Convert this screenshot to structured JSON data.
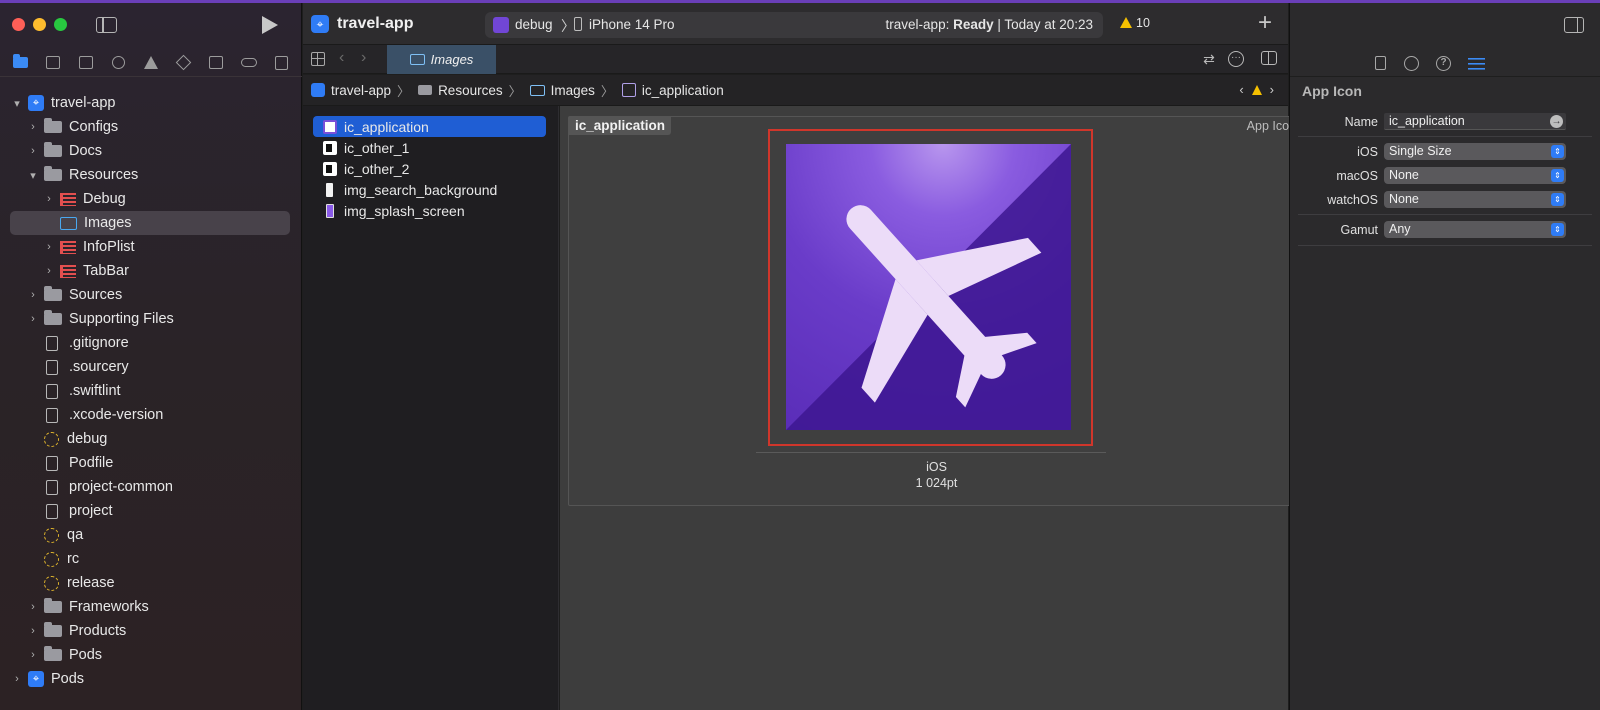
{
  "window": {
    "project_title": "travel-app",
    "scheme": "debug",
    "device": "iPhone 14 Pro",
    "status_prefix": "travel-app:",
    "status_state": "Ready",
    "status_suffix": "| Today at 20:23",
    "warnings_count": "10",
    "accent_color": "#6a3fb8"
  },
  "navigator": {
    "tree": [
      {
        "label": "travel-app",
        "icon": "app-icon",
        "level": 0,
        "disclosure": "▾"
      },
      {
        "label": "Configs",
        "icon": "folder-icon",
        "level": 1,
        "disclosure": "›"
      },
      {
        "label": "Docs",
        "icon": "folder-icon",
        "level": 1,
        "disclosure": "›"
      },
      {
        "label": "Resources",
        "icon": "folder-icon",
        "level": 1,
        "disclosure": "▾"
      },
      {
        "label": "Debug",
        "icon": "strings-icon",
        "level": 2,
        "disclosure": "›"
      },
      {
        "label": "Images",
        "icon": "images-icon",
        "level": 2,
        "disclosure": "",
        "selected": true
      },
      {
        "label": "InfoPlist",
        "icon": "strings-icon",
        "level": 2,
        "disclosure": "›"
      },
      {
        "label": "TabBar",
        "icon": "strings-icon",
        "level": 2,
        "disclosure": "›"
      },
      {
        "label": "Sources",
        "icon": "folder-icon",
        "level": 1,
        "disclosure": "›"
      },
      {
        "label": "Supporting Files",
        "icon": "folder-icon",
        "level": 1,
        "disclosure": "›"
      },
      {
        "label": ".gitignore",
        "icon": "doc-icon",
        "level": 1,
        "disclosure": ""
      },
      {
        "label": ".sourcery",
        "icon": "doc-icon",
        "level": 1,
        "disclosure": ""
      },
      {
        "label": ".swiftlint",
        "icon": "doc-icon",
        "level": 1,
        "disclosure": ""
      },
      {
        "label": ".xcode-version",
        "icon": "doc-icon",
        "level": 1,
        "disclosure": ""
      },
      {
        "label": "debug",
        "icon": "config-icon",
        "level": 1,
        "disclosure": ""
      },
      {
        "label": "Podfile",
        "icon": "doc-icon",
        "level": 1,
        "disclosure": ""
      },
      {
        "label": "project-common",
        "icon": "doc-icon",
        "level": 1,
        "disclosure": ""
      },
      {
        "label": "project",
        "icon": "doc-icon",
        "level": 1,
        "disclosure": ""
      },
      {
        "label": "qa",
        "icon": "config-icon",
        "level": 1,
        "disclosure": ""
      },
      {
        "label": "rc",
        "icon": "config-icon",
        "level": 1,
        "disclosure": ""
      },
      {
        "label": "release",
        "icon": "config-icon",
        "level": 1,
        "disclosure": ""
      },
      {
        "label": "Frameworks",
        "icon": "folder-icon",
        "level": 1,
        "disclosure": "›"
      },
      {
        "label": "Products",
        "icon": "folder-icon",
        "level": 1,
        "disclosure": "›"
      },
      {
        "label": "Pods",
        "icon": "folder-icon",
        "level": 1,
        "disclosure": "›"
      },
      {
        "label": "Pods",
        "icon": "app-icon",
        "level": 0,
        "disclosure": "›"
      }
    ]
  },
  "editor": {
    "tab_label": "Images",
    "breadcrumb": [
      "travel-app",
      "Resources",
      "Images",
      "ic_application"
    ],
    "assets": [
      {
        "label": "ic_application",
        "icon": "appicon-asset-icon",
        "selected": true
      },
      {
        "label": "ic_other_1",
        "icon": "image-asset-icon"
      },
      {
        "label": "ic_other_2",
        "icon": "image-asset-icon"
      },
      {
        "label": "img_search_background",
        "icon": "white-image-icon"
      },
      {
        "label": "img_splash_screen",
        "icon": "splash-image-icon"
      }
    ],
    "canvas": {
      "asset_name": "ic_application",
      "asset_type": "App Icon",
      "slot_platform": "iOS",
      "slot_size": "1 024pt",
      "icon_image": "airplane-icon"
    }
  },
  "inspector": {
    "section_title": "App Icon",
    "name_label": "Name",
    "name_value": "ic_application",
    "ios_label": "iOS",
    "ios_value": "Single Size",
    "macos_label": "macOS",
    "macos_value": "None",
    "watchos_label": "watchOS",
    "watchos_value": "None",
    "gamut_label": "Gamut",
    "gamut_value": "Any"
  }
}
